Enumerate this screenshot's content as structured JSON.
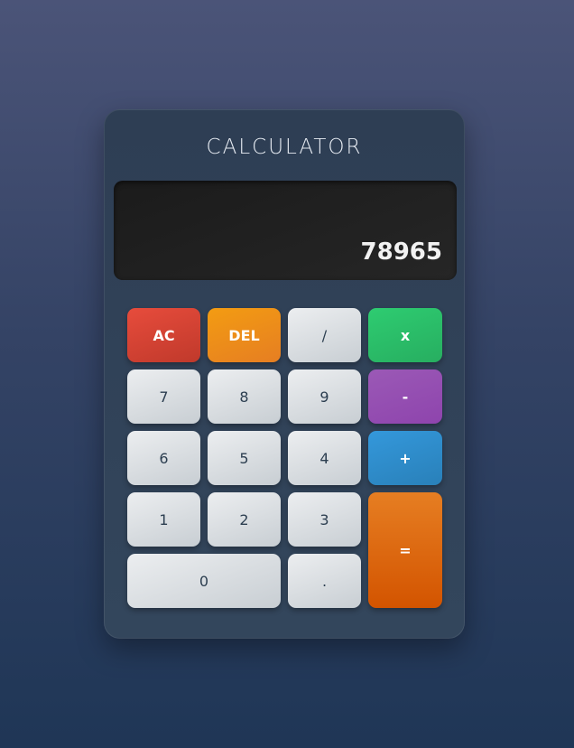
{
  "app": {
    "title": "CALCULATOR"
  },
  "display": {
    "value": "78965"
  },
  "keys": {
    "ac": "AC",
    "del": "DEL",
    "divide": "/",
    "multiply": "x",
    "seven": "7",
    "eight": "8",
    "nine": "9",
    "subtract": "-",
    "six": "6",
    "five": "5",
    "four": "4",
    "add": "+",
    "one": "1",
    "two": "2",
    "three": "3",
    "equals": "=",
    "zero": "0",
    "decimal": "."
  },
  "colors": {
    "ac": "#e74c3c",
    "del": "#f39c12",
    "multiply": "#2ecc71",
    "subtract": "#9b59b6",
    "add": "#3498db",
    "equals": "#e67e22",
    "number_key": "#e3e6e9",
    "display_bg": "#1f1f1f",
    "panel_bg": "#2f4056"
  }
}
